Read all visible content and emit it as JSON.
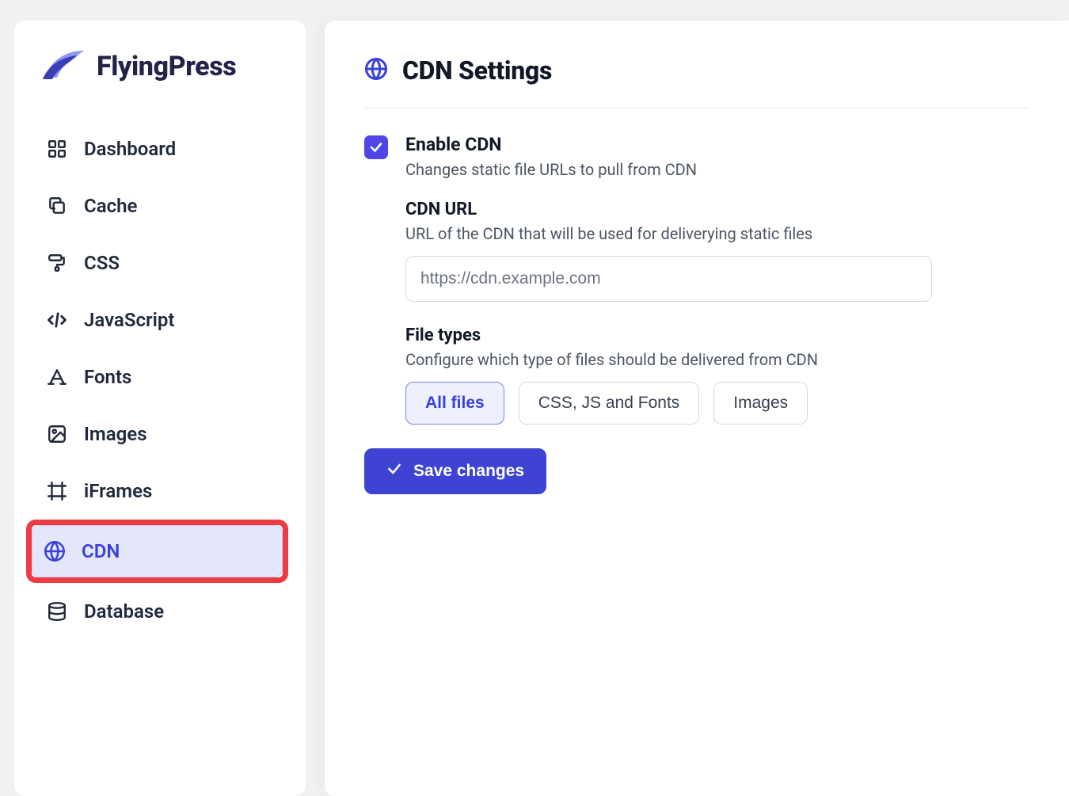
{
  "brand": {
    "name": "FlyingPress"
  },
  "sidebar": {
    "items": [
      {
        "label": "Dashboard"
      },
      {
        "label": "Cache"
      },
      {
        "label": "CSS"
      },
      {
        "label": "JavaScript"
      },
      {
        "label": "Fonts"
      },
      {
        "label": "Images"
      },
      {
        "label": "iFrames"
      },
      {
        "label": "CDN"
      },
      {
        "label": "Database"
      }
    ]
  },
  "page": {
    "title": "CDN Settings",
    "enable": {
      "title": "Enable CDN",
      "desc": "Changes static file URLs to pull from CDN",
      "checked": true
    },
    "cdn_url": {
      "title": "CDN URL",
      "desc": "URL of the CDN that will be used for deliverying static files",
      "placeholder": "https://cdn.example.com",
      "value": ""
    },
    "file_types": {
      "title": "File types",
      "desc": "Configure which type of files should be delivered from CDN",
      "options": [
        "All files",
        "CSS, JS and Fonts",
        "Images"
      ],
      "selected": "All files"
    },
    "save_label": "Save changes"
  }
}
